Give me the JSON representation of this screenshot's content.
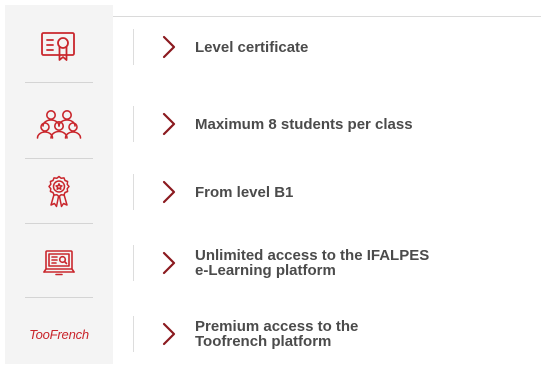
{
  "features": [
    {
      "icon": "certificate-icon",
      "label": "Level certificate"
    },
    {
      "icon": "students-group-icon",
      "label": "Maximum 8 students per class"
    },
    {
      "icon": "award-medal-icon",
      "label": "From level B1"
    },
    {
      "icon": "laptop-elearning-icon",
      "label": "Unlimited access to the IFALPES\ne-Learning platform"
    },
    {
      "icon": "toofrench-logo",
      "label": "Premium access to the\nToofrench platform",
      "logo_text": "TooFrench"
    }
  ],
  "colors": {
    "accent": "#c9262c",
    "chevron": "#8b1a1f",
    "label": "#4b4b4b",
    "panel": "#f4f4f4"
  }
}
